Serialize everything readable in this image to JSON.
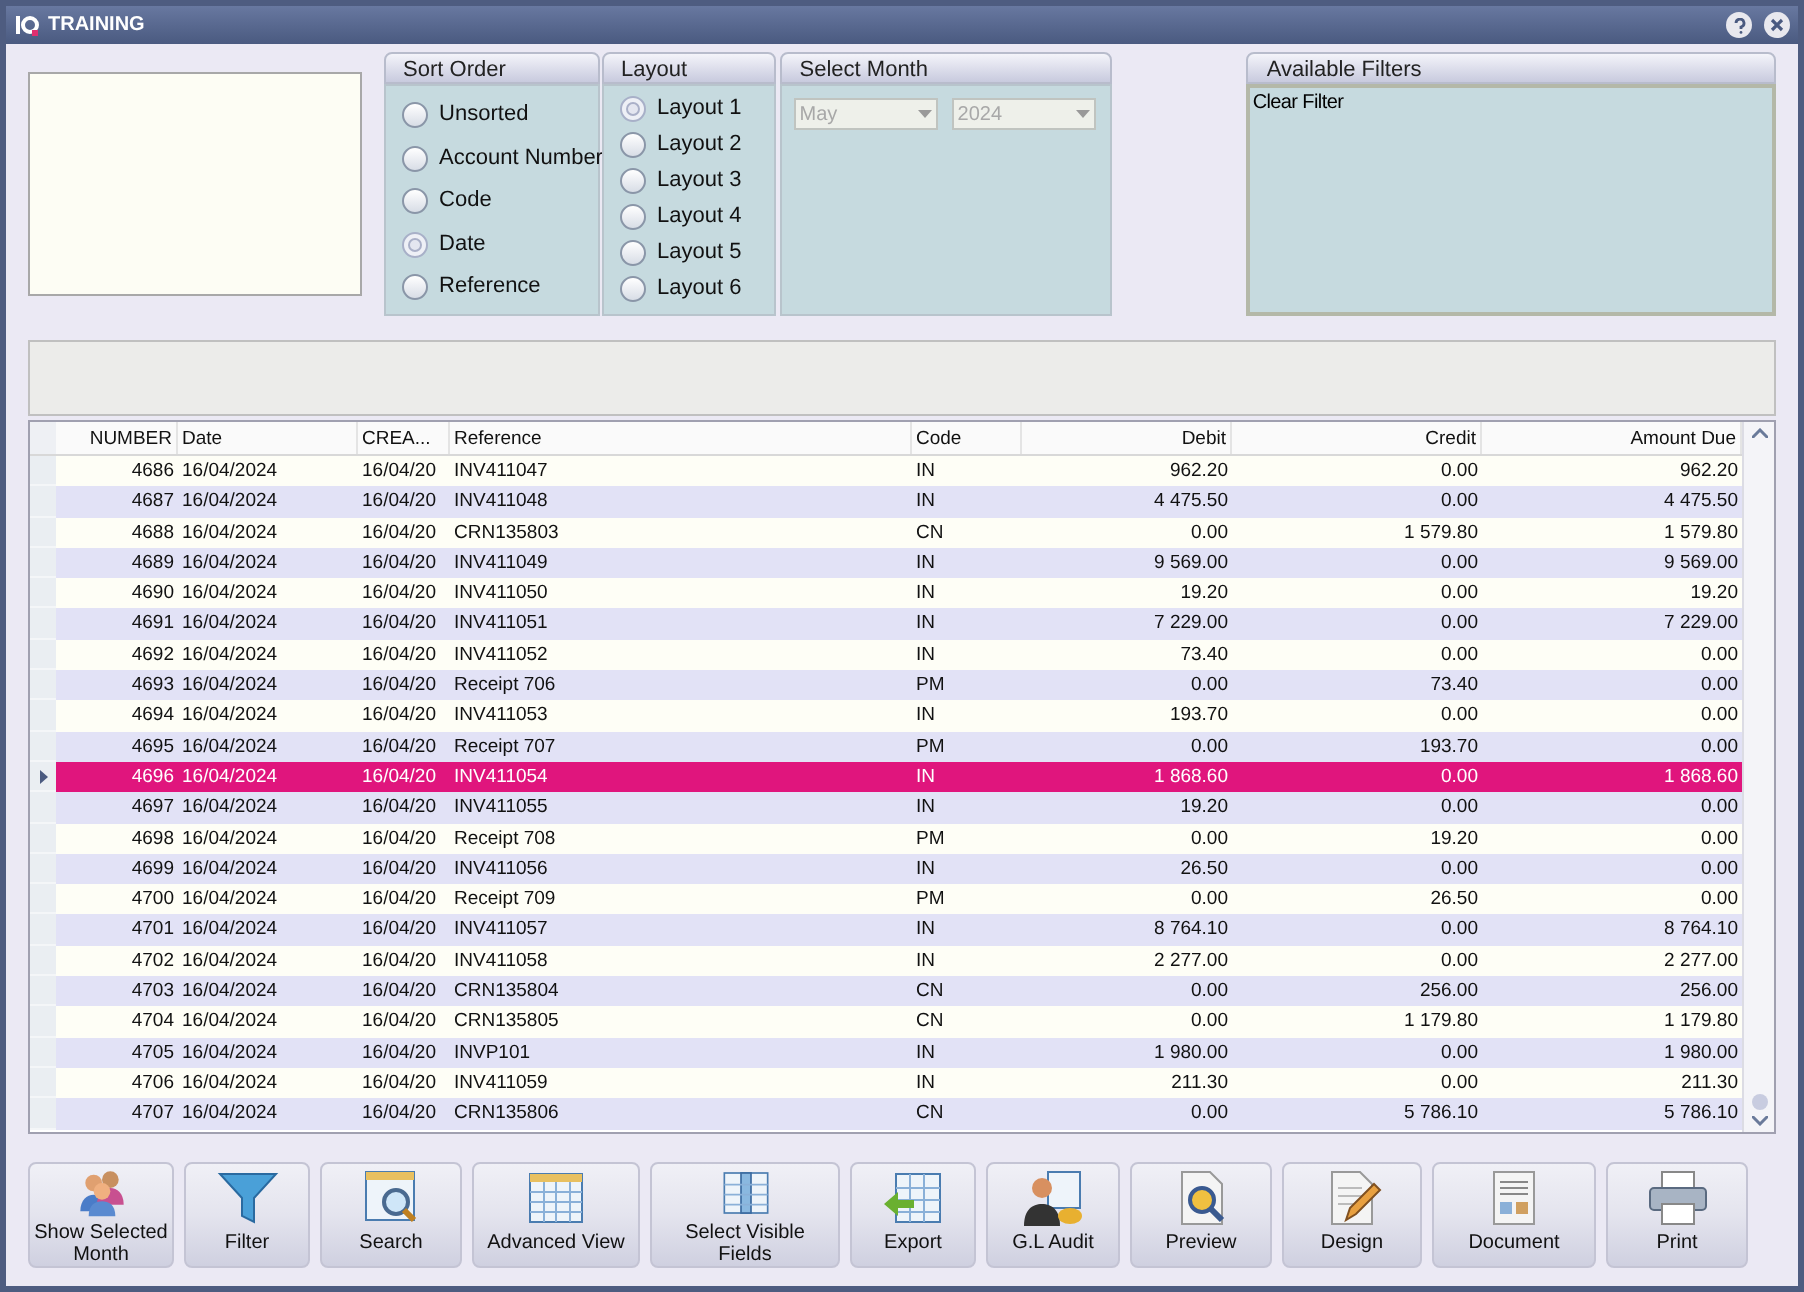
{
  "window": {
    "title": "TRAINING"
  },
  "sort_order": {
    "title": "Sort Order",
    "options": [
      {
        "label": "Unsorted",
        "selected": false
      },
      {
        "label": "Account Number",
        "selected": false
      },
      {
        "label": "Code",
        "selected": false
      },
      {
        "label": "Date",
        "selected": true
      },
      {
        "label": "Reference",
        "selected": false
      }
    ]
  },
  "layout": {
    "title": "Layout",
    "options": [
      {
        "label": "Layout 1",
        "selected": true
      },
      {
        "label": "Layout 2",
        "selected": false
      },
      {
        "label": "Layout 3",
        "selected": false
      },
      {
        "label": "Layout 4",
        "selected": false
      },
      {
        "label": "Layout 5",
        "selected": false
      },
      {
        "label": "Layout 6",
        "selected": false
      }
    ]
  },
  "select_month": {
    "title": "Select Month",
    "month": "May",
    "year": "2024",
    "disabled": true
  },
  "available_filters": {
    "title": "Available Filters",
    "items": [
      "Clear Filter"
    ]
  },
  "table": {
    "columns": [
      "NUMBER",
      "Date",
      "CREA...",
      "Reference",
      "Code",
      "Debit",
      "Credit",
      "Amount Due"
    ],
    "rows": [
      {
        "cells": [
          "4686",
          "16/04/2024",
          "16/04/20",
          "INV411047",
          "IN",
          "962.20",
          "0.00",
          "962.20"
        ],
        "selected": false
      },
      {
        "cells": [
          "4687",
          "16/04/2024",
          "16/04/20",
          "INV411048",
          "IN",
          "4 475.50",
          "0.00",
          "4 475.50"
        ],
        "selected": false
      },
      {
        "cells": [
          "4688",
          "16/04/2024",
          "16/04/20",
          "CRN135803",
          "CN",
          "0.00",
          "1 579.80",
          "1 579.80"
        ],
        "selected": false
      },
      {
        "cells": [
          "4689",
          "16/04/2024",
          "16/04/20",
          "INV411049",
          "IN",
          "9 569.00",
          "0.00",
          "9 569.00"
        ],
        "selected": false
      },
      {
        "cells": [
          "4690",
          "16/04/2024",
          "16/04/20",
          "INV411050",
          "IN",
          "19.20",
          "0.00",
          "19.20"
        ],
        "selected": false
      },
      {
        "cells": [
          "4691",
          "16/04/2024",
          "16/04/20",
          "INV411051",
          "IN",
          "7 229.00",
          "0.00",
          "7 229.00"
        ],
        "selected": false
      },
      {
        "cells": [
          "4692",
          "16/04/2024",
          "16/04/20",
          "INV411052",
          "IN",
          "73.40",
          "0.00",
          "0.00"
        ],
        "selected": false
      },
      {
        "cells": [
          "4693",
          "16/04/2024",
          "16/04/20",
          "Receipt 706",
          "PM",
          "0.00",
          "73.40",
          "0.00"
        ],
        "selected": false
      },
      {
        "cells": [
          "4694",
          "16/04/2024",
          "16/04/20",
          "INV411053",
          "IN",
          "193.70",
          "0.00",
          "0.00"
        ],
        "selected": false
      },
      {
        "cells": [
          "4695",
          "16/04/2024",
          "16/04/20",
          "Receipt 707",
          "PM",
          "0.00",
          "193.70",
          "0.00"
        ],
        "selected": false
      },
      {
        "cells": [
          "4696",
          "16/04/2024",
          "16/04/20",
          "INV411054",
          "IN",
          "1 868.60",
          "0.00",
          "1 868.60"
        ],
        "selected": true
      },
      {
        "cells": [
          "4697",
          "16/04/2024",
          "16/04/20",
          "INV411055",
          "IN",
          "19.20",
          "0.00",
          "0.00"
        ],
        "selected": false
      },
      {
        "cells": [
          "4698",
          "16/04/2024",
          "16/04/20",
          "Receipt 708",
          "PM",
          "0.00",
          "19.20",
          "0.00"
        ],
        "selected": false
      },
      {
        "cells": [
          "4699",
          "16/04/2024",
          "16/04/20",
          "INV411056",
          "IN",
          "26.50",
          "0.00",
          "0.00"
        ],
        "selected": false
      },
      {
        "cells": [
          "4700",
          "16/04/2024",
          "16/04/20",
          "Receipt 709",
          "PM",
          "0.00",
          "26.50",
          "0.00"
        ],
        "selected": false
      },
      {
        "cells": [
          "4701",
          "16/04/2024",
          "16/04/20",
          "INV411057",
          "IN",
          "8 764.10",
          "0.00",
          "8 764.10"
        ],
        "selected": false
      },
      {
        "cells": [
          "4702",
          "16/04/2024",
          "16/04/20",
          "INV411058",
          "IN",
          "2 277.00",
          "0.00",
          "2 277.00"
        ],
        "selected": false
      },
      {
        "cells": [
          "4703",
          "16/04/2024",
          "16/04/20",
          "CRN135804",
          "CN",
          "0.00",
          "256.00",
          "256.00"
        ],
        "selected": false
      },
      {
        "cells": [
          "4704",
          "16/04/2024",
          "16/04/20",
          "CRN135805",
          "CN",
          "0.00",
          "1 179.80",
          "1 179.80"
        ],
        "selected": false
      },
      {
        "cells": [
          "4705",
          "16/04/2024",
          "16/04/20",
          "INVP101",
          "IN",
          "1 980.00",
          "0.00",
          "1 980.00"
        ],
        "selected": false
      },
      {
        "cells": [
          "4706",
          "16/04/2024",
          "16/04/20",
          "INV411059",
          "IN",
          "211.30",
          "0.00",
          "211.30"
        ],
        "selected": false
      },
      {
        "cells": [
          "4707",
          "16/04/2024",
          "16/04/20",
          "CRN135806",
          "CN",
          "0.00",
          "5 786.10",
          "5 786.10"
        ],
        "selected": false
      }
    ]
  },
  "toolbar": [
    {
      "label": "Show Selected Month",
      "kind": "people"
    },
    {
      "label": "Filter",
      "kind": "funnel"
    },
    {
      "label": "Search",
      "kind": "search"
    },
    {
      "label": "Advanced View",
      "kind": "grid"
    },
    {
      "label": "Select Visible Fields",
      "kind": "columns"
    },
    {
      "label": "Export",
      "kind": "export"
    },
    {
      "label": "G.L Audit",
      "kind": "person"
    },
    {
      "label": "Preview",
      "kind": "preview"
    },
    {
      "label": "Design",
      "kind": "design"
    },
    {
      "label": "Document",
      "kind": "document"
    },
    {
      "label": "Print",
      "kind": "printer"
    }
  ]
}
